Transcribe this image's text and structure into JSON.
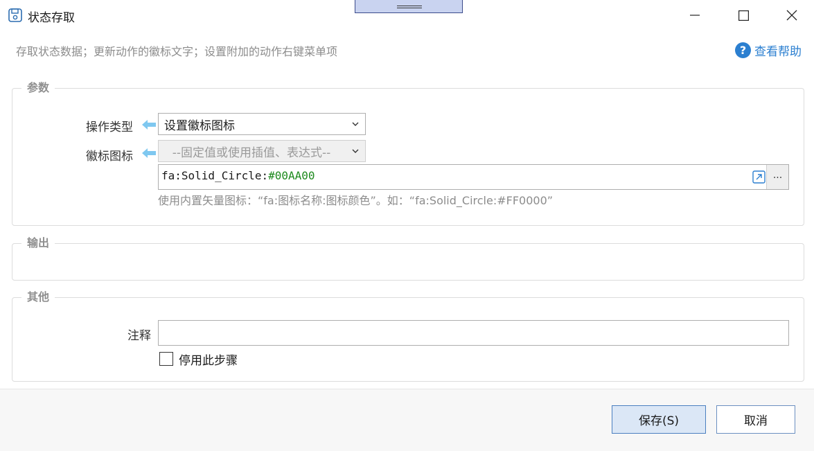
{
  "window": {
    "title": "状态存取"
  },
  "header": {
    "subtitle": "存取状态数据；更新动作的徽标文字；设置附加的动作右键菜单项",
    "help_label": "查看帮助",
    "help_icon": "?"
  },
  "params": {
    "legend": "参数",
    "operation_type": {
      "label": "操作类型",
      "value": "设置徽标图标"
    },
    "badge_icon": {
      "label": "徽标图标",
      "mode_value": "--固定值或使用插值、表达式--",
      "expression_prefix": "fa:Solid_Circle:",
      "expression_color": "#00AA00",
      "more_label": "...",
      "hint": "使用内置矢量图标：“fa:图标名称:图标颜色”。如：“fa:Solid_Circle:#FF0000”"
    }
  },
  "output": {
    "legend": "输出"
  },
  "other": {
    "legend": "其他",
    "note_label": "注释",
    "note_value": "",
    "disable_step_label": "停用此步骤",
    "disable_step_checked": false
  },
  "footer": {
    "save_label": "保存(S)",
    "cancel_label": "取消"
  },
  "colors": {
    "accent": "#2b7fd0",
    "expression_value": "#1d8a1d",
    "arrow": "#7fc8f0"
  }
}
